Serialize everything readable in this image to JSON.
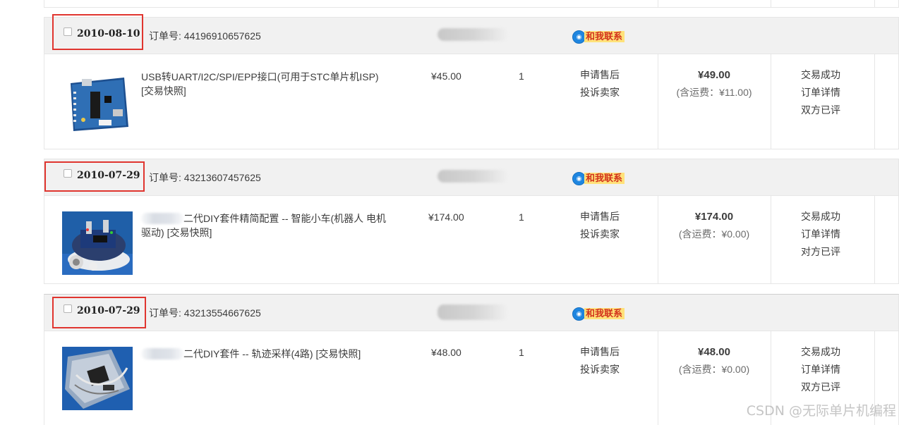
{
  "orders": [
    {
      "date": "2010-08-10",
      "order_no": "订单号: 44196910657625",
      "contact_label": "和我联系",
      "item_title": "USB转UART/I2C/SPI/EPP接口(可用于STC单片机ISP)",
      "snapshot": "[交易快照]",
      "price": "¥45.00",
      "quantity": "1",
      "actions": [
        "申请售后",
        "投诉卖家"
      ],
      "total": "¥49.00",
      "shipping": "(含运费：¥11.00)",
      "status": [
        "交易成功",
        "订单详情",
        "双方已评"
      ],
      "thumb_icon": "usb-board-image"
    },
    {
      "date": "2010-07-29",
      "order_no": "订单号: 43213607457625",
      "contact_label": "和我联系",
      "item_title": "二代DIY套件精简配置 -- 智能小车(机器人 电机",
      "item_title_line2": "驱动)",
      "snapshot": "[交易快照]",
      "price": "¥174.00",
      "quantity": "1",
      "actions": [
        "申请售后",
        "投诉卖家"
      ],
      "total": "¥174.00",
      "shipping": "(含运费：¥0.00)",
      "status": [
        "交易成功",
        "订单详情",
        "对方已评"
      ],
      "thumb_icon": "robot-car-image"
    },
    {
      "date": "2010-07-29",
      "order_no": "订单号: 43213554667625",
      "contact_label": "和我联系",
      "item_title": "二代DIY套件 -- 轨迹采样(4路)",
      "snapshot": "[交易快照]",
      "price": "¥48.00",
      "quantity": "1",
      "actions": [
        "申请售后",
        "投诉卖家"
      ],
      "total": "¥48.00",
      "shipping": "(含运费：¥0.00)",
      "status": [
        "交易成功",
        "订单详情",
        "双方已评"
      ],
      "thumb_icon": "sensor-kit-image"
    }
  ],
  "watermark": "CSDN @无际单片机编程",
  "colors": {
    "highlight": "#e0352f",
    "contact_bg": "#ffe27a",
    "contact_text": "#d2311c",
    "header_bg": "#f1f1f1"
  }
}
